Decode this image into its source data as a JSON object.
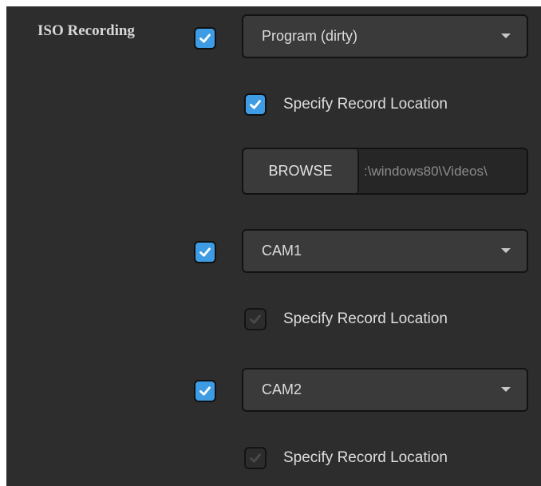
{
  "iso_recording": {
    "label": "ISO Recording",
    "enabled": true,
    "accent_color": "#3d9ce3",
    "check_icon": "checkmark-icon",
    "dropdown_icon": "caret-down-icon"
  },
  "program": {
    "enabled": true,
    "source": "Program (dirty)",
    "specify_location_label": "Specify Record Location",
    "specify_location_checked": true,
    "browse_label": "BROWSE",
    "path": ":\\windows80\\Videos\\"
  },
  "cam1": {
    "enabled": true,
    "source": "CAM1",
    "specify_location_label": "Specify Record Location",
    "specify_location_checked": false
  },
  "cam2": {
    "enabled": true,
    "source": "CAM2",
    "specify_location_label": "Specify Record Location",
    "specify_location_checked": false
  }
}
